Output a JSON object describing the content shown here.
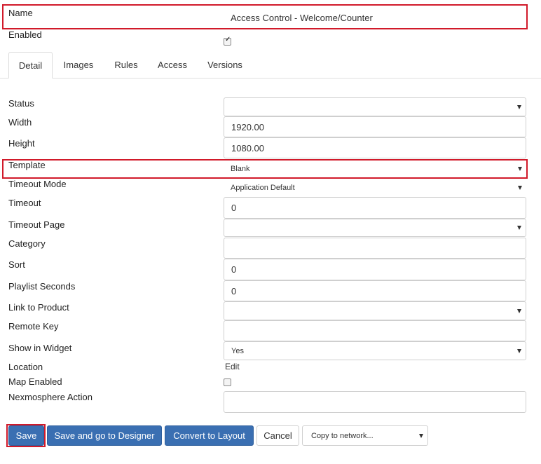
{
  "header": {
    "name_label": "Name",
    "name_value": "Access Control - Welcome/Counter",
    "enabled_label": "Enabled",
    "enabled_checked": true
  },
  "tabs": [
    {
      "label": "Detail",
      "active": true
    },
    {
      "label": "Images"
    },
    {
      "label": "Rules"
    },
    {
      "label": "Access"
    },
    {
      "label": "Versions"
    }
  ],
  "fields": {
    "status": {
      "label": "Status",
      "value": ""
    },
    "width": {
      "label": "Width",
      "value": "1920.00"
    },
    "height": {
      "label": "Height",
      "value": "1080.00"
    },
    "template": {
      "label": "Template",
      "value": "Blank"
    },
    "timeout_mode": {
      "label": "Timeout Mode",
      "value": "Application Default"
    },
    "timeout": {
      "label": "Timeout",
      "value": "0"
    },
    "timeout_page": {
      "label": "Timeout Page",
      "value": ""
    },
    "category": {
      "label": "Category",
      "value": ""
    },
    "sort": {
      "label": "Sort",
      "value": "0"
    },
    "playlist_seconds": {
      "label": "Playlist Seconds",
      "value": "0"
    },
    "link_to_product": {
      "label": "Link to Product",
      "value": ""
    },
    "remote_key": {
      "label": "Remote Key",
      "value": ""
    },
    "show_in_widget": {
      "label": "Show in Widget",
      "value": "Yes"
    },
    "location": {
      "label": "Location",
      "link": "Edit"
    },
    "map_enabled": {
      "label": "Map Enabled",
      "checked": false
    },
    "nexmosphere_action": {
      "label": "Nexmosphere Action",
      "value": ""
    }
  },
  "actions": {
    "save": "Save",
    "save_designer": "Save and go to Designer",
    "convert": "Convert to Layout",
    "cancel": "Cancel",
    "copy_placeholder": "Copy to network..."
  },
  "colors": {
    "highlight": "#d11a2a",
    "primary": "#3a6fb2"
  }
}
